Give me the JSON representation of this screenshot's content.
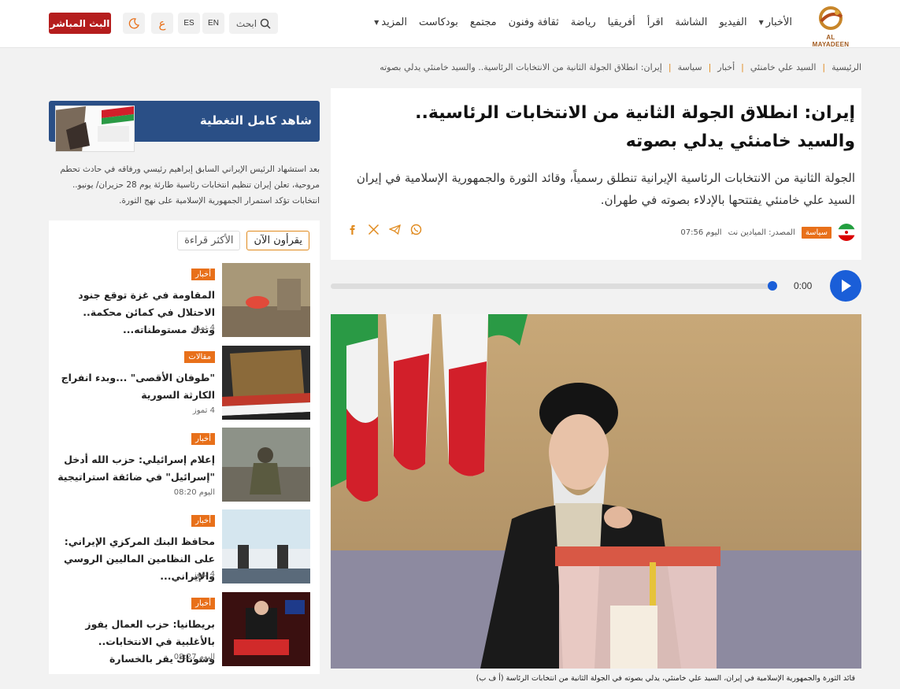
{
  "header": {
    "logo_text": "AL MAYADEEN",
    "nav": [
      {
        "label": "الأخبار",
        "dropdown": true
      },
      {
        "label": "الفيديو",
        "dropdown": false
      },
      {
        "label": "الشاشة",
        "dropdown": false
      },
      {
        "label": "اقرأ",
        "dropdown": false
      },
      {
        "label": "أفريقيا",
        "dropdown": false
      },
      {
        "label": "رياضة",
        "dropdown": false
      },
      {
        "label": "ثقافة وفنون",
        "dropdown": false
      },
      {
        "label": "مجتمع",
        "dropdown": false
      },
      {
        "label": "بودكاست",
        "dropdown": false
      },
      {
        "label": "المزيد",
        "dropdown": true
      }
    ],
    "search_label": "ابحث",
    "lang_en": "EN",
    "lang_es": "ES",
    "lang_ar": "ع",
    "live_label": "البث المباشر",
    "accent_color": "#b51d1d"
  },
  "breadcrumb": [
    "الرئيسية",
    "السيد علي خامنئي",
    "أخبار",
    "سياسة",
    "إيران: انطلاق الجولة الثانية من الانتخابات الرئاسية.. والسيد خامنئي يدلي بصوته"
  ],
  "article": {
    "title": "إيران: انطلاق الجولة الثانية من الانتخابات الرئاسية.. والسيد خامنئي يدلي بصوته",
    "lead": "الجولة الثانية من الانتخابات الرئاسية الإيرانية تنطلق رسمياً، وقائد الثورة والجمهورية الإسلامية في إيران السيد علي خامنئي يفتتحها بالإدلاء بصوته في طهران.",
    "category": "سياسة",
    "source": "المصدر: الميادين نت",
    "time": "اليوم 07:56",
    "caption": "قائد الثورة والجمهورية الإسلامية في إيران، السيد علي خامنئي، يدلي بصوته في الجولة الثانية من انتخابات الرئاسة (أ ف ب)"
  },
  "share": [
    "whatsapp-icon",
    "telegram-icon",
    "x-icon",
    "facebook-icon"
  ],
  "player": {
    "time": "0:00",
    "progress": 0
  },
  "sidebar": {
    "coverage_title": "شاهد كامل التغطية",
    "coverage_desc": "بعد استشهاد الرئيس الإيراني السابق إبراهيم رئيسي ورفاقه في حادث تحطم مروحية، تعلن إيران تنظيم انتخابات رئاسية طارئة يوم 28 حزيران/ يونيو.. انتخابات تؤكد استمرار الجمهورية الإسلامية على نهج الثورة.",
    "tab_active": "يقرأون الآن",
    "tab_inactive": "الأكثر قراءة",
    "items": [
      {
        "badge": "أخبار",
        "title": "المقاومة في غزة توقع جنود الاحتلال في كمائن محكمة.. وتدك مستوطناته...",
        "date": "4 تموز"
      },
      {
        "badge": "مقالات",
        "title": "\"طوفان الأقصى\" ...وبدء انفراج الكارثة السورية",
        "date": "4 تموز"
      },
      {
        "badge": "أخبار",
        "title": "إعلام إسرائيلي: حزب الله أدخل \"إسرائيل\" في ضائقة استراتيجية",
        "date": "اليوم 08:20"
      },
      {
        "badge": "أخبار",
        "title": "محافظ البنك المركزي الإيراني: على النظامين الماليين الروسي والإيراني...",
        "date": "4 تموز"
      },
      {
        "badge": "أخبار",
        "title": "بريطانيا: حزب العمال يفوز بالأغلبية في الانتخابات.. وسوناك يقر بالخسارة",
        "date": "اليوم 08:27"
      }
    ]
  }
}
